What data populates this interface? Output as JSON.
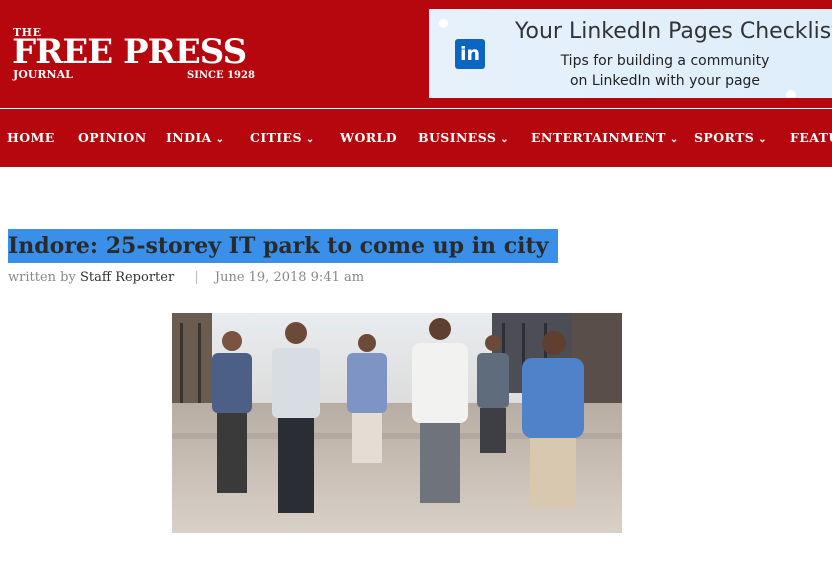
{
  "brand": {
    "the": "THE",
    "name": "FREE PRESS",
    "journal": "JOURNAL",
    "since": "SINCE 1928"
  },
  "ad": {
    "title": "Your LinkedIn Pages Checklist",
    "line1": "Tips for building a community",
    "line2": "on LinkedIn with your page",
    "icon": "linkedin-icon",
    "logo_text": "in"
  },
  "nav": {
    "items": [
      {
        "label": "HOME"
      },
      {
        "label": "OPINION"
      },
      {
        "label": "INDIA",
        "dropdown": true
      },
      {
        "label": "CITIES",
        "dropdown": true
      },
      {
        "label": "WORLD"
      },
      {
        "label": "BUSINESS",
        "dropdown": true
      },
      {
        "label": "ENTERTAINMENT",
        "dropdown": true
      },
      {
        "label": "SPORTS",
        "dropdown": true
      },
      {
        "label": "FEATU"
      }
    ],
    "chevron": "⌄"
  },
  "article": {
    "title": "Indore: 25-storey IT park to come up in city",
    "written_by": "written by",
    "author": "Staff Reporter",
    "separator": "|",
    "date": "June 19, 2018 9:41 am"
  },
  "colors": {
    "brand_red": "#b5070d",
    "highlight": "#3a8fe8",
    "linkedin_blue": "#0a66c2"
  }
}
